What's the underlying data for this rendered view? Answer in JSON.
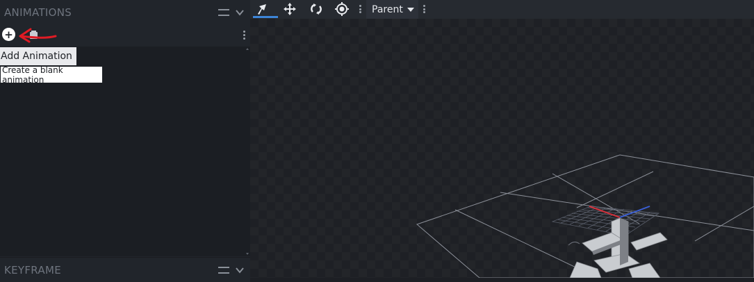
{
  "animations_panel": {
    "title": "ANIMATIONS",
    "add_menu": {
      "item_label": "Add Animation",
      "tooltip": "Create a blank animation"
    }
  },
  "keyframe_panel": {
    "title": "KEYFRAME"
  },
  "viewport_toolbar": {
    "tools": [
      "pivot-tool-icon",
      "move-tool-icon",
      "rotate-tool-icon",
      "transform-origin-icon"
    ],
    "active_tool": "pivot-tool-icon",
    "space_select": "Parent"
  },
  "colors": {
    "accent": "#3d85d8",
    "annotation_red": "#e01b24",
    "axis_x": "#d1303a",
    "axis_z": "#3a5fd8"
  }
}
